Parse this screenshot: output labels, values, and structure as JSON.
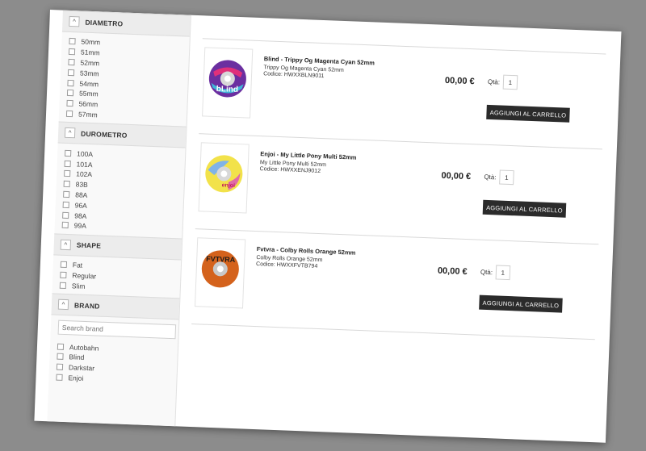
{
  "filters": [
    {
      "title": "DIAMETRO",
      "toggle": "^",
      "options": [
        "50mm",
        "51mm",
        "52mm",
        "53mm",
        "54mm",
        "55mm",
        "56mm",
        "57mm"
      ]
    },
    {
      "title": "DUROMETRO",
      "toggle": "^",
      "options": [
        "100A",
        "101A",
        "102A",
        "83B",
        "88A",
        "96A",
        "98A",
        "99A"
      ]
    },
    {
      "title": "SHAPE",
      "toggle": "^",
      "options": [
        "Fat",
        "Regular",
        "Slim"
      ]
    },
    {
      "title": "BRAND",
      "toggle": "^",
      "search_placeholder": "Search brand",
      "options": [
        "Autobahn",
        "Blind",
        "Darkstar",
        "Enjoi"
      ]
    }
  ],
  "products": [
    {
      "title": "Blind - Trippy Og Magenta Cyan 52mm",
      "description": "Trippy Og Magenta Cyan 52mm",
      "code": "Codice: HWXXBLN9011",
      "price": "00,00 €",
      "qty_label": "Qtà:",
      "qty": "1",
      "button": "AGGIUNGI AL CARRELLO",
      "wheel_color": "#6b2fa0",
      "wheel_accent": "#e0307a"
    },
    {
      "title": "Enjoi - My Little Pony Multi 52mm",
      "description": "My Little Pony Multi 52mm",
      "code": "Codice: HWXXENJ9012",
      "price": "00,00 €",
      "qty_label": "Qtà:",
      "qty": "1",
      "button": "AGGIUNGI AL CARRELLO",
      "wheel_color": "#f2e24a",
      "wheel_accent": "#7fb3e8"
    },
    {
      "title": "Fvtvra - Colby Rolls Orange 52mm",
      "description": "Colby Rolls Orange 52mm",
      "code": "Codice: HWXXFVTB794",
      "price": "00,00 €",
      "qty_label": "Qtà:",
      "qty": "1",
      "button": "AGGIUNGI AL CARRELLO",
      "wheel_color": "#d4621c",
      "wheel_accent": "#222222"
    }
  ],
  "wheel_labels": [
    "bLind",
    "enjoi",
    "FVTVRA"
  ]
}
